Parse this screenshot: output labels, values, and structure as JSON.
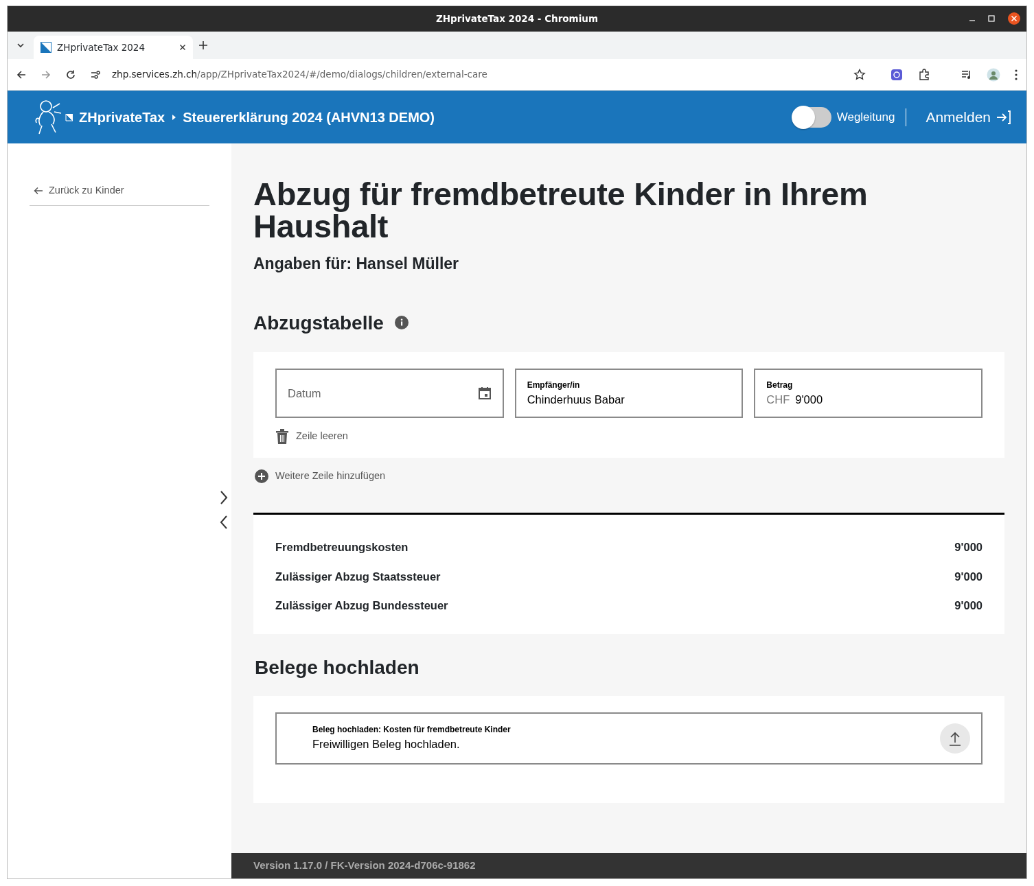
{
  "browser": {
    "window_title": "ZHprivateTax 2024 - Chromium",
    "tabs": [
      {
        "title": "ZHprivateTax 2024",
        "selected": true
      }
    ],
    "url_host": "zhp.services.zh.ch",
    "url_path": "/app/ZHprivateTax2024/#/demo/dialogs/children/external-care"
  },
  "header": {
    "brand": "ZHprivateTax",
    "breadcrumb": "Steuererklärung 2024 (AHVN13 DEMO)",
    "guide_toggle": {
      "label": "Wegleitung",
      "on": false
    },
    "login": "Anmelden"
  },
  "sidebar": {
    "back_link": "Zurück zu Kinder"
  },
  "page": {
    "title": "Abzug für fremdbetreute Kinder in Ihrem Haushalt",
    "subtitle": "Angaben für: Hansel Müller"
  },
  "deduction_table": {
    "heading": "Abzugstabelle",
    "rows": [
      {
        "fields": [
          {
            "kind": "date",
            "placeholder": "Datum"
          },
          {
            "kind": "text",
            "label": "Empfänger/in",
            "value": "Chinderhuus Babar"
          },
          {
            "kind": "amount",
            "label": "Betrag",
            "prefix": "CHF",
            "value": "9'000"
          }
        ],
        "clear_label": "Zeile leeren"
      }
    ],
    "add_row": "Weitere Zeile hinzufügen"
  },
  "summary": [
    {
      "label": "Fremdbetreuungskosten",
      "value": "9'000"
    },
    {
      "label": "Zulässiger Abzug Staatssteuer",
      "value": "9'000"
    },
    {
      "label": "Zulässiger Abzug Bundessteuer",
      "value": "9'000"
    }
  ],
  "uploads": {
    "heading": "Belege hochladen",
    "items": [
      {
        "label": "Beleg hochladen: Kosten für fremdbetreute Kinder",
        "text": "Freiwilligen Beleg hochladen."
      }
    ]
  },
  "footer": "Version 1.17.0 / FK-Version 2024-d706c-91862"
}
